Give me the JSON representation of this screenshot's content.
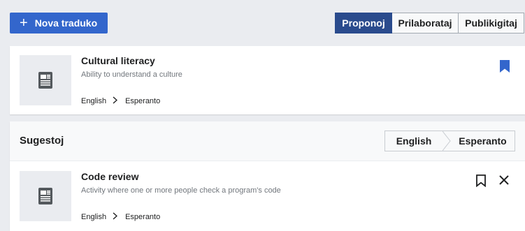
{
  "toolbar": {
    "new_label": "Nova traduko",
    "tabs": [
      {
        "label": "Proponoj",
        "active": true
      },
      {
        "label": "Prilaborataj",
        "active": false
      },
      {
        "label": "Publikigitaj",
        "active": false
      }
    ]
  },
  "favorite": {
    "title": "Cultural literacy",
    "description": "Ability to understand a culture",
    "source_lang": "English",
    "target_lang": "Esperanto",
    "icon": "bookmark-filled-icon"
  },
  "suggestions": {
    "heading": "Sugestoj",
    "source_lang": "English",
    "target_lang": "Esperanto",
    "items": [
      {
        "title": "Code review",
        "description": "Activity where one or more people check a program's code",
        "source_lang": "English",
        "target_lang": "Esperanto"
      }
    ]
  },
  "colors": {
    "accent": "#3366cc",
    "active_tab": "#2a4b8d",
    "page_bg": "#eaecf0",
    "muted_text": "#72777d"
  }
}
